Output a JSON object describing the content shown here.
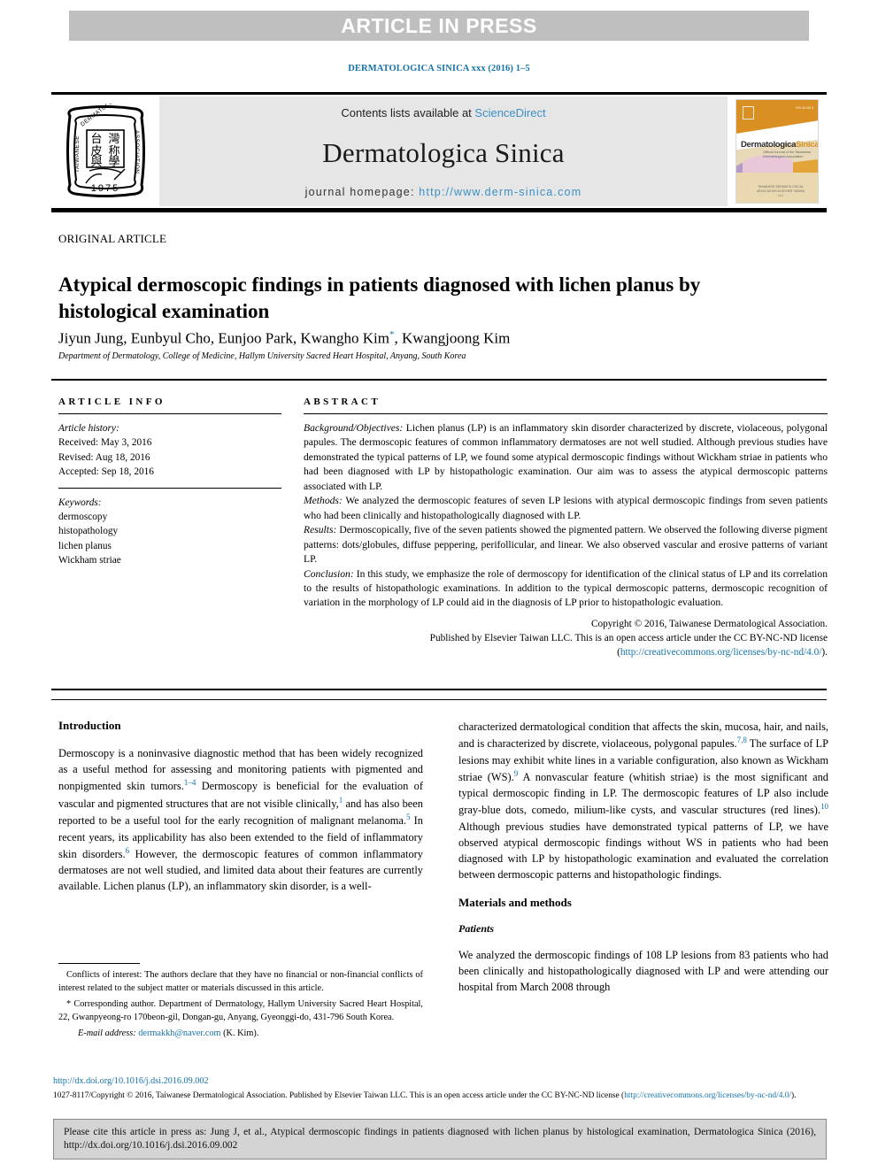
{
  "banner": {
    "text": "ARTICLE IN PRESS"
  },
  "running_citation": "DERMATOLOGICA SINICA xxx (2016) 1–5",
  "masthead": {
    "contents_prefix": "Contents lists available at ",
    "contents_link": "ScienceDirect",
    "journal_title": "Dermatologica Sinica",
    "homepage_label": "journal homepage: ",
    "homepage_url": "http://www.derm-sinica.com",
    "society_seal": {
      "outer_text_left": "TAIWANESE",
      "outer_text_top": "DERMATOLOGICAL",
      "outer_text_right": "ASSOCIATION",
      "characters": "台湾皮膚科醫學會",
      "year": "1975"
    },
    "cover": {
      "title_dark": "Dermatologica",
      "title_orange": "Sinica",
      "subtitle": "Official Journal of the Taiwanese Dermatological Association",
      "footer": "TAIWANESE DERMATOLOGICAL ASSOCIATION\nELSEVIER TAIWAN LLC"
    }
  },
  "article": {
    "kind": "ORIGINAL ARTICLE",
    "title": "Atypical dermoscopic findings in patients diagnosed with lichen planus by histological examination",
    "authors": "Jiyun Jung, Eunbyul Cho, Eunjoo Park, Kwangho Kim",
    "authors_tail": ", Kwangjoong Kim",
    "corresponding_marker": "*",
    "affiliation": "Department of Dermatology, College of Medicine, Hallym University Sacred Heart Hospital, Anyang, South Korea"
  },
  "article_info": {
    "heading": "ARTICLE INFO",
    "history_label": "Article history:",
    "history": [
      "Received: May 3, 2016",
      "Revised: Aug 18, 2016",
      "Accepted: Sep 18, 2016"
    ],
    "keywords_label": "Keywords:",
    "keywords": [
      "dermoscopy",
      "histopathology",
      "lichen planus",
      "Wickham striae"
    ]
  },
  "abstract": {
    "heading": "ABSTRACT",
    "sections": [
      {
        "label": "Background/Objectives:",
        "text": " Lichen planus (LP) is an inflammatory skin disorder characterized by discrete, violaceous, polygonal papules. The dermoscopic features of common inflammatory dermatoses are not well studied. Although previous studies have demonstrated the typical patterns of LP, we found some atypical dermoscopic findings without Wickham striae in patients who had been diagnosed with LP by histopathologic examination. Our aim was to assess the atypical dermoscopic patterns associated with LP."
      },
      {
        "label": "Methods:",
        "text": " We analyzed the dermoscopic features of seven LP lesions with atypical dermoscopic findings from seven patients who had been clinically and histopathologically diagnosed with LP."
      },
      {
        "label": "Results:",
        "text": " Dermoscopically, five of the seven patients showed the pigmented pattern. We observed the following diverse pigment patterns: dots/globules, diffuse peppering, perifollicular, and linear. We also observed vascular and erosive patterns of variant LP."
      },
      {
        "label": "Conclusion:",
        "text": " In this study, we emphasize the role of dermoscopy for identification of the clinical status of LP and its correlation to the results of histopathologic examinations. In addition to the typical dermoscopic patterns, dermoscopic recognition of variation in the morphology of LP could aid in the diagnosis of LP prior to histopathologic evaluation."
      }
    ],
    "copyright_line1": "Copyright © 2016, Taiwanese Dermatological Association.",
    "copyright_line2": "Published by Elsevier Taiwan LLC. This is an open access article under the CC BY-NC-ND license (",
    "copyright_link": "http://creativecommons.org/licenses/by-nc-nd/4.0/",
    "copyright_tail": ")."
  },
  "body": {
    "left": {
      "heading": "Introduction",
      "paragraph": "Dermoscopy is a noninvasive diagnostic method that has been widely recognized as a useful method for assessing and monitoring patients with pigmented and nonpigmented skin tumors.",
      "ref1": "1–4",
      "paragraph_b": " Dermoscopy is beneficial for the evaluation of vascular and pigmented structures that are not visible clinically,",
      "ref2": "1",
      "paragraph_c": " and has also been reported to be a useful tool for the early recognition of malignant melanoma.",
      "ref3": "5",
      "paragraph_d": " In recent years, its applicability has also been extended to the field of inflammatory skin disorders.",
      "ref4": "6",
      "paragraph_e": " However, the dermoscopic features of common inflammatory dermatoses are not well studied, and limited data about their features are currently available. Lichen planus (LP), an inflammatory skin disorder, is a well-"
    },
    "right": {
      "continuation_a": "characterized dermatological condition that affects the skin, mucosa, hair, and nails, and is characterized by discrete, violaceous, polygonal papules.",
      "ref_a": "7,8",
      "continuation_b": " The surface of LP lesions may exhibit white lines in a variable configuration, also known as Wickham striae (WS).",
      "ref_b": "9",
      "continuation_c": " A nonvascular feature (whitish striae) is the most significant and typical dermoscopic finding in LP. The dermoscopic features of LP also include gray-blue dots, comedo, milium-like cysts, and vascular structures (red lines).",
      "ref_c": "10",
      "continuation_d": " Although previous studies have demonstrated typical patterns of LP, we have observed atypical dermoscopic findings without WS in patients who had been diagnosed with LP by histopathologic examination and evaluated the correlation between dermoscopic patterns and histopathologic findings.",
      "heading_methods": "Materials and methods",
      "heading_patients": "Patients",
      "patients_paragraph": "We analyzed the dermoscopic findings of 108 LP lesions from 83 patients who had been clinically and histopathologically diagnosed with LP and were attending our hospital from March 2008 through"
    }
  },
  "footnotes": {
    "conflicts": "Conflicts of interest: The authors declare that they have no financial or non-financial conflicts of interest related to the subject matter or materials discussed in this article.",
    "corresponding": "* Corresponding author. Department of Dermatology, Hallym University Sacred Heart Hospital, 22, Gwanpyeong-ro 170beon-gil, Dongan-gu, Anyang, Gyeonggi-do, 431-796 South Korea.",
    "email_label": "E-mail address: ",
    "email": "dermakkh@naver.com",
    "email_tail": " (K. Kim)."
  },
  "page_footer": {
    "doi": "http://dx.doi.org/10.1016/j.dsi.2016.09.002",
    "issn_copyright": "1027-8117/Copyright © 2016, Taiwanese Dermatological Association. Published by Elsevier Taiwan LLC. This is an open access article under the CC BY-NC-ND license (",
    "license_link": "http://creativecommons.org/licenses/by-nc-nd/4.0/",
    "license_tail": ")."
  },
  "cite_box": {
    "text": "Please cite this article in press as: Jung J, et al., Atypical dermoscopic findings in patients diagnosed with lichen planus by histological examination, Dermatologica Sinica (2016), http://dx.doi.org/10.1016/j.dsi.2016.09.002"
  },
  "colors": {
    "link": "#1673a8",
    "banner_bg": "#bfbfbf",
    "masthead_bg": "#e6e6e6",
    "cite_box_bg": "#d4d4d4",
    "cover_orange": "#d98f22"
  }
}
